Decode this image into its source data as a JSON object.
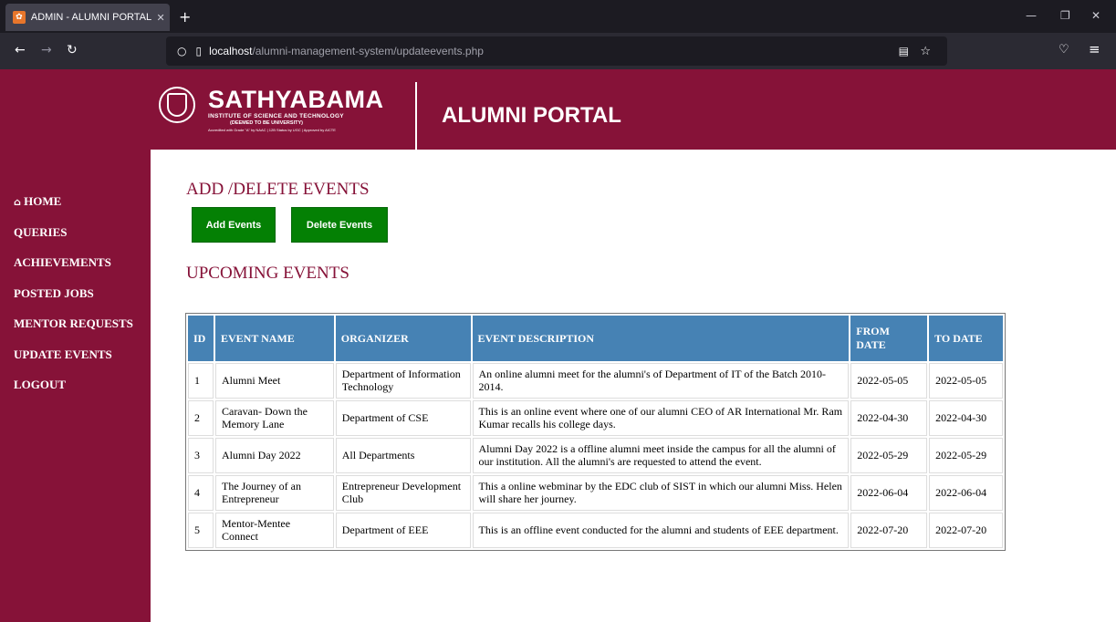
{
  "browser": {
    "tab_title": "ADMIN - ALUMNI PORTAL",
    "favicon": "xampp-icon",
    "url_host": "localhost",
    "url_path": "/alumni-management-system/updateevents.php"
  },
  "header": {
    "logo_name": "SATHYABAMA",
    "logo_sub": "INSTITUTE OF SCIENCE AND TECHNOLOGY",
    "logo_sub2": "(DEEMED TO BE UNIVERSITY)",
    "logo_accreditation": "Accredited with Grade \"A\" by NAAC | 12B Status by UGC | Approved by AICTE",
    "portal_title": "ALUMNI PORTAL",
    "brand_color": "#861238"
  },
  "sidebar": {
    "items": [
      {
        "label": "HOME",
        "icon": "home-icon"
      },
      {
        "label": "QUERIES"
      },
      {
        "label": "ACHIEVEMENTS"
      },
      {
        "label": "POSTED JOBS"
      },
      {
        "label": "MENTOR REQUESTS"
      },
      {
        "label": "UPDATE EVENTS"
      },
      {
        "label": "LOGOUT"
      }
    ]
  },
  "main": {
    "section_title": "ADD /DELETE EVENTS",
    "add_button": "Add Events",
    "delete_button": "Delete Events",
    "upcoming_title": "UPCOMING EVENTS",
    "table": {
      "headers": [
        "ID",
        "EVENT NAME",
        "ORGANIZER",
        "EVENT DESCRIPTION",
        "FROM DATE",
        "TO DATE"
      ],
      "rows": [
        [
          "1",
          "Alumni Meet",
          "Department of Information Technology",
          "An online alumni meet for the alumni's of Department of IT of the Batch 2010-2014.",
          "2022-05-05",
          "2022-05-05"
        ],
        [
          "2",
          "Caravan- Down the Memory Lane",
          "Department of CSE",
          "This is an online event where one of our alumni CEO of AR International Mr. Ram Kumar recalls his college days.",
          "2022-04-30",
          "2022-04-30"
        ],
        [
          "3",
          "Alumni Day 2022",
          "All Departments",
          "Alumni Day 2022 is a offline alumni meet inside the campus for all the alumni of our institution. All the alumni's are requested to attend the event.",
          "2022-05-29",
          "2022-05-29"
        ],
        [
          "4",
          "The Journey of an Entrepreneur",
          "Entrepreneur Development Club",
          "This a online webminar by the EDC club of SIST in which our alumni Miss. Helen will share her journey.",
          "2022-06-04",
          "2022-06-04"
        ],
        [
          "5",
          "Mentor-Mentee Connect",
          "Department of EEE",
          "This is an offline event conducted for the alumni and students of EEE department.",
          "2022-07-20",
          "2022-07-20"
        ]
      ]
    },
    "button_color": "#048004",
    "header_color": "#4682b4"
  }
}
